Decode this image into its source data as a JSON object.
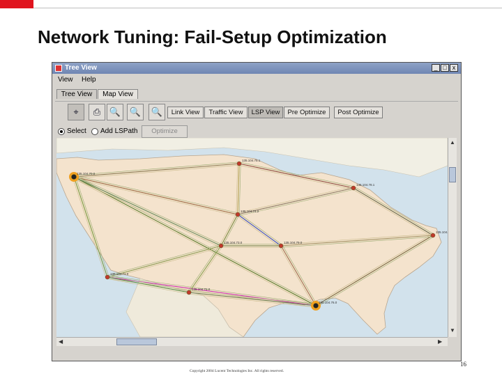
{
  "slide": {
    "title": "Network Tuning: Fail-Setup Optimization",
    "page_number": "16",
    "copyright": "Copyright 2004 Lucent Technologies Inc. All rights reserved.",
    "accent_color": "#e0141e"
  },
  "window": {
    "title": "Tree View",
    "controls": [
      "_",
      "□",
      "x"
    ],
    "menu": [
      "View",
      "Help"
    ],
    "tabs": [
      {
        "label": "Tree View",
        "active": false
      },
      {
        "label": "Map View",
        "active": true
      }
    ]
  },
  "toolbar": {
    "icons": [
      "pointer-icon",
      "print-icon",
      "zoom-in-icon",
      "zoom-out-icon",
      "zoom-fit-icon"
    ],
    "buttons": [
      {
        "label": "Link View",
        "pressed": false
      },
      {
        "label": "Traffic View",
        "pressed": false
      },
      {
        "label": "LSP View",
        "pressed": true
      },
      {
        "label": "Pre Optimize",
        "pressed": false
      },
      {
        "label": "Post Optimize",
        "pressed": false
      }
    ]
  },
  "mode": {
    "select_label": "Select",
    "select_checked": true,
    "add_lsp_label": "Add LSPath",
    "add_lsp_checked": false,
    "optimize_label": "Optimize",
    "optimize_enabled": false
  },
  "map": {
    "land_color": "#f4e3cd",
    "water_color": "#d2e2ec",
    "failed_node_color": "#f0a020",
    "node_color": "#c0392b",
    "nodes": [
      {
        "id": "seattle",
        "label": "135.104.70.0",
        "failed": true
      },
      {
        "id": "chicago-n",
        "label": "135.104.75.1",
        "failed": false
      },
      {
        "id": "northeast",
        "label": "135.104.78.1",
        "failed": false
      },
      {
        "id": "boston",
        "label": "135.104.74.0",
        "failed": false
      },
      {
        "id": "midwest",
        "label": "135.104.74.2",
        "failed": false
      },
      {
        "id": "central",
        "label": "135.104.79.0",
        "failed": false
      },
      {
        "id": "kansas",
        "label": "135.104.73.0",
        "failed": false
      },
      {
        "id": "la",
        "label": "135.104.71.0",
        "failed": false
      },
      {
        "id": "texas-w",
        "label": "135.104.72.0",
        "failed": false
      },
      {
        "id": "houston",
        "label": "135.104.76.0",
        "failed": true
      }
    ]
  }
}
